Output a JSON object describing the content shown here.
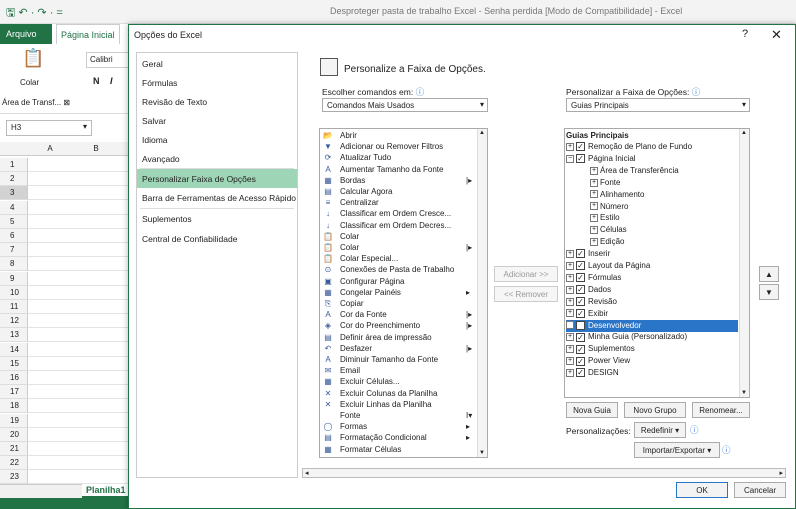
{
  "window": {
    "title": "Desproteger pasta de trabalho Excel - Senha perdida  [Modo de Compatibilidade]  -  Excel",
    "qat": "🖫 ↶ · ↷ · ="
  },
  "excel": {
    "tab_file": "Arquivo",
    "tab_home": "Página Inicial",
    "paste_label": "Colar",
    "font_name": "Calibri",
    "bold": "N",
    "italic": "I",
    "clipboard_group": "Área de Transf... ⊠",
    "name_box": "H3",
    "col_headers": [
      "A",
      "B"
    ],
    "rows": [
      "1",
      "2",
      "3",
      "4",
      "5",
      "6",
      "7",
      "8",
      "9",
      "10",
      "11",
      "12",
      "13",
      "14",
      "15",
      "16",
      "17",
      "18",
      "19",
      "20",
      "21",
      "22",
      "23"
    ],
    "sheet_name": "Planilha1"
  },
  "dialog": {
    "title": "Opções do Excel",
    "help": "?",
    "close": "✕",
    "nav": [
      "Geral",
      "Fórmulas",
      "Revisão de Texto",
      "Salvar",
      "Idioma",
      "Avançado",
      "Personalizar Faixa de Opções",
      "Barra de Ferramentas de Acesso Rápido",
      "Suplementos",
      "Central de Confiabilidade"
    ],
    "nav_selected": "Personalizar Faixa de Opções",
    "heading": "Personalize a Faixa de Opções.",
    "choose_label": "Escolher comandos em:",
    "choose_value": "Comandos Mais Usados",
    "customize_label": "Personalizar a Faixa de Opções:",
    "customize_value": "Guias Principais",
    "info_icon": "ⓘ",
    "commands": [
      {
        "label": "Abrir",
        "icon": "📂",
        "sub": ""
      },
      {
        "label": "Adicionar ou Remover Filtros",
        "icon": "▼",
        "sub": ""
      },
      {
        "label": "Atualizar Tudo",
        "icon": "⟳",
        "sub": ""
      },
      {
        "label": "Aumentar Tamanho da Fonte",
        "icon": "A",
        "sub": ""
      },
      {
        "label": "Bordas",
        "icon": "▦",
        "sub": "|▸"
      },
      {
        "label": "Calcular Agora",
        "icon": "▤",
        "sub": ""
      },
      {
        "label": "Centralizar",
        "icon": "≡",
        "sub": ""
      },
      {
        "label": "Classificar em Ordem Cresce...",
        "icon": "↓",
        "sub": ""
      },
      {
        "label": "Classificar em Ordem Decres...",
        "icon": "↓",
        "sub": ""
      },
      {
        "label": "Colar",
        "icon": "📋",
        "sub": ""
      },
      {
        "label": "Colar",
        "icon": "📋",
        "sub": "|▸"
      },
      {
        "label": "Colar Especial...",
        "icon": "📋",
        "sub": ""
      },
      {
        "label": "Conexões de Pasta de Trabalho",
        "icon": "⊙",
        "sub": ""
      },
      {
        "label": "Configurar Página",
        "icon": "▣",
        "sub": ""
      },
      {
        "label": "Congelar Painéis",
        "icon": "▦",
        "sub": "▸"
      },
      {
        "label": "Copiar",
        "icon": "⎘",
        "sub": ""
      },
      {
        "label": "Cor da Fonte",
        "icon": "A",
        "sub": "|▸"
      },
      {
        "label": "Cor do Preenchimento",
        "icon": "◈",
        "sub": "|▸"
      },
      {
        "label": "Definir área de impressão",
        "icon": "▤",
        "sub": ""
      },
      {
        "label": "Desfazer",
        "icon": "↶",
        "sub": "|▸"
      },
      {
        "label": "Diminuir Tamanho da Fonte",
        "icon": "A",
        "sub": ""
      },
      {
        "label": "Email",
        "icon": "✉",
        "sub": ""
      },
      {
        "label": "Excluir Células...",
        "icon": "▦",
        "sub": ""
      },
      {
        "label": "Excluir Colunas da Planilha",
        "icon": "✕",
        "sub": ""
      },
      {
        "label": "Excluir Linhas da Planilha",
        "icon": "✕",
        "sub": ""
      },
      {
        "label": "Fonte",
        "icon": "",
        "sub": "I▾"
      },
      {
        "label": "Formas",
        "icon": "◯",
        "sub": "▸"
      },
      {
        "label": "Formatação Condicional",
        "icon": "▤",
        "sub": "▸"
      },
      {
        "label": "Formatar Células",
        "icon": "▦",
        "sub": ""
      }
    ],
    "add_button": "Adicionar >>",
    "remove_button": "<< Remover",
    "tree_header": "Guias Principais",
    "tree": [
      {
        "label": "Remoção de Plano de Fundo",
        "level": 0,
        "pm": "⊞",
        "check": "✓"
      },
      {
        "label": "Página Inicial",
        "level": 0,
        "pm": "⊟",
        "check": "✓"
      },
      {
        "label": "Área de Transferência",
        "level": 1,
        "pm": "⊞",
        "check": ""
      },
      {
        "label": "Fonte",
        "level": 1,
        "pm": "⊞",
        "check": ""
      },
      {
        "label": "Alinhamento",
        "level": 1,
        "pm": "⊞",
        "check": ""
      },
      {
        "label": "Número",
        "level": 1,
        "pm": "⊞",
        "check": ""
      },
      {
        "label": "Estilo",
        "level": 1,
        "pm": "⊞",
        "check": ""
      },
      {
        "label": "Células",
        "level": 1,
        "pm": "⊞",
        "check": ""
      },
      {
        "label": "Edição",
        "level": 1,
        "pm": "⊞",
        "check": ""
      },
      {
        "label": "Inserir",
        "level": 0,
        "pm": "⊞",
        "check": "✓"
      },
      {
        "label": "Layout da Página",
        "level": 0,
        "pm": "⊞",
        "check": "✓"
      },
      {
        "label": "Fórmulas",
        "level": 0,
        "pm": "⊞",
        "check": "✓"
      },
      {
        "label": "Dados",
        "level": 0,
        "pm": "⊞",
        "check": "✓"
      },
      {
        "label": "Revisão",
        "level": 0,
        "pm": "⊞",
        "check": "✓"
      },
      {
        "label": "Exibir",
        "level": 0,
        "pm": "⊞",
        "check": "✓"
      },
      {
        "label": "Desenvolvedor",
        "level": 0,
        "pm": "⊞",
        "check": "✓"
      },
      {
        "label": "Minha Guia (Personalizado)",
        "level": 0,
        "pm": "⊞",
        "check": "✓"
      },
      {
        "label": "Suplementos",
        "level": 0,
        "pm": "⊞",
        "check": "✓"
      },
      {
        "label": "Power View",
        "level": 0,
        "pm": "⊞",
        "check": "✓"
      },
      {
        "label": "DESIGN",
        "level": 0,
        "pm": "⊞",
        "check": "✓"
      }
    ],
    "tree_highlighted": "Desenvolvedor",
    "move_up": "▲",
    "move_down": "▼",
    "new_tab": "Nova Guia",
    "new_group": "Novo Grupo",
    "rename": "Renomear...",
    "customizations_label": "Personalizações:",
    "reset": "Redefinir ▾",
    "import_export": "Importar/Exportar ▾",
    "ok": "OK",
    "cancel": "Cancelar"
  },
  "colors": {
    "excel_green": "#217346",
    "nav_selected": "#9fd5b7",
    "tree_highlight": "#2b75c8"
  }
}
